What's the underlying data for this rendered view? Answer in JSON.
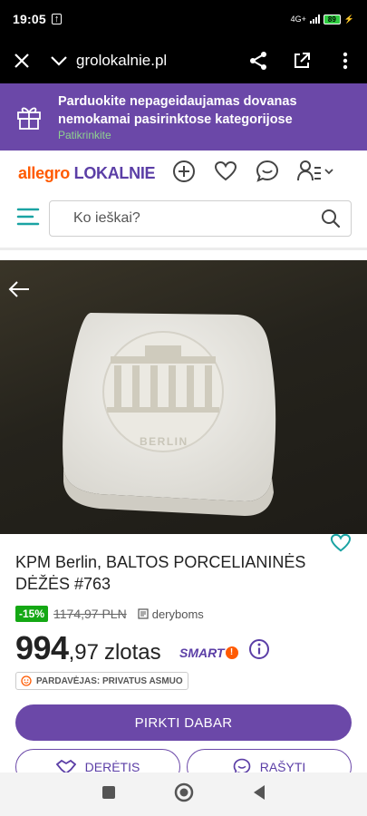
{
  "status": {
    "time": "19:05",
    "network": "4G+",
    "battery": "89"
  },
  "browser": {
    "url": "grolokalnie.pl"
  },
  "banner": {
    "line1": "Parduokite nepageidaujamas dovanas",
    "line2": "nemokamai pasirinktose kategorijose",
    "link": "Patikrinkite"
  },
  "header": {
    "logo_allegro": "allegro",
    "logo_lokalnie": "LOKALNIE",
    "search_placeholder": "Ko ieškai?"
  },
  "product": {
    "title": "KPM Berlin, BALTOS PORCELIANINĖS DĖŽĖS #763",
    "discount": "-15%",
    "old_price": "1174,97 PLN",
    "negotiation": "deryboms",
    "price_int": "994",
    "price_frac": ",97",
    "currency": "zlotas",
    "smart": "SMART",
    "seller_label": "PARDAVĖJAS: PRIVATUS ASMUO",
    "image_text": "BERLIN"
  },
  "actions": {
    "buy": "PIRKTI DABAR",
    "negotiate": "DERĖTIS",
    "write": "RAŠYTI"
  },
  "colors": {
    "brand_purple": "#6b48a8",
    "allegro_orange": "#ff5a00",
    "discount_green": "#14a814"
  }
}
